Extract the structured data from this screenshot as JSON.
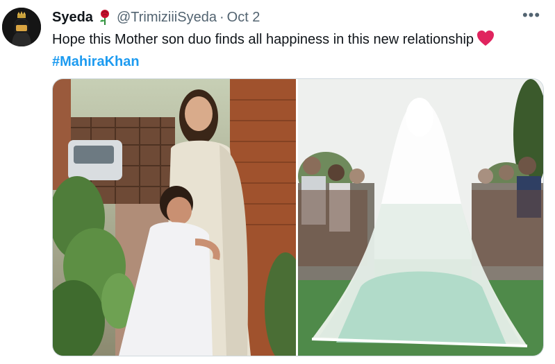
{
  "tweet": {
    "author_name": "Syeda",
    "author_emoji": "rose-emoji",
    "handle": "@TrimiziiiSyeda",
    "separator": "·",
    "date": "Oct 2",
    "more_label": "•••",
    "text": "Hope this Mother son duo finds all happiness in this new relationship",
    "text_emoji": "red-heart-emoji",
    "hashtag": "#MahiraKhan"
  },
  "colors": {
    "link": "#1d9bf0",
    "secondary_text": "#536471",
    "primary_text": "#0f1419",
    "border": "#cfd9de"
  },
  "media": [
    {
      "name": "photo-mother-son-hug"
    },
    {
      "name": "photo-bridal-veil"
    }
  ]
}
